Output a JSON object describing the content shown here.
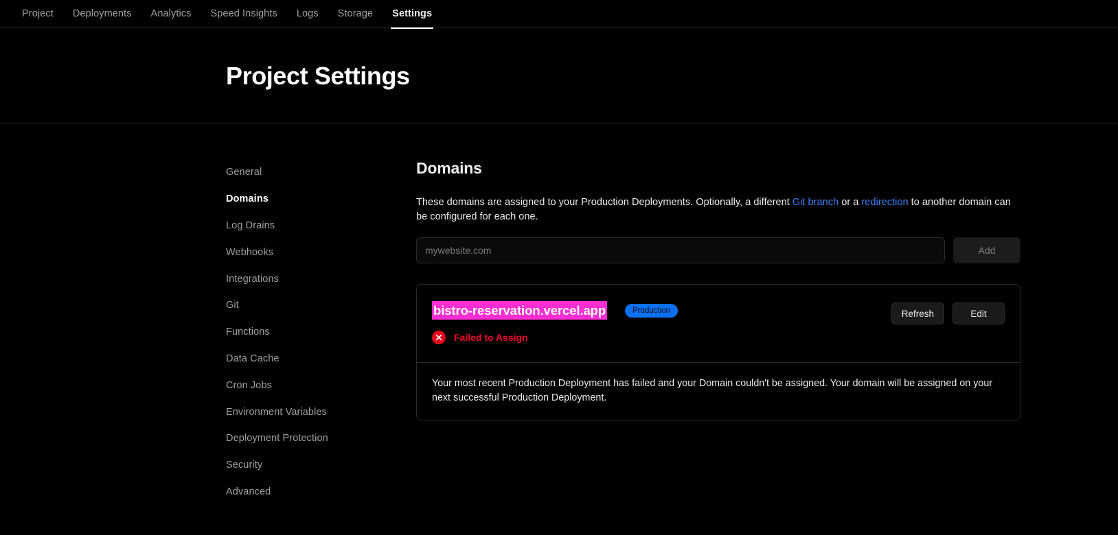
{
  "topnav": {
    "items": [
      {
        "label": "Project",
        "active": false
      },
      {
        "label": "Deployments",
        "active": false
      },
      {
        "label": "Analytics",
        "active": false
      },
      {
        "label": "Speed Insights",
        "active": false
      },
      {
        "label": "Logs",
        "active": false
      },
      {
        "label": "Storage",
        "active": false
      },
      {
        "label": "Settings",
        "active": true
      }
    ]
  },
  "header": {
    "title": "Project Settings"
  },
  "sidebar": {
    "items": [
      {
        "label": "General",
        "active": false
      },
      {
        "label": "Domains",
        "active": true
      },
      {
        "label": "Log Drains",
        "active": false
      },
      {
        "label": "Webhooks",
        "active": false
      },
      {
        "label": "Integrations",
        "active": false
      },
      {
        "label": "Git",
        "active": false
      },
      {
        "label": "Functions",
        "active": false
      },
      {
        "label": "Data Cache",
        "active": false
      },
      {
        "label": "Cron Jobs",
        "active": false
      },
      {
        "label": "Environment Variables",
        "active": false
      },
      {
        "label": "Deployment Protection",
        "active": false
      },
      {
        "label": "Security",
        "active": false
      },
      {
        "label": "Advanced",
        "active": false
      }
    ]
  },
  "main": {
    "section_title": "Domains",
    "description": {
      "part1": "These domains are assigned to your Production Deployments. Optionally, a different ",
      "link1": "Git branch",
      "part2": " or a ",
      "link2": "redirection",
      "part3": " to another domain can be configured for each one."
    },
    "add_form": {
      "input_value": "",
      "input_placeholder": "mywebsite.com",
      "add_label": "Add"
    },
    "domain_card": {
      "domain_name": "bistro-reservation.vercel.app",
      "domain_highlight_color": "#ff2ed2",
      "badge_label": "Production",
      "badge_color": "#0c70f2",
      "status_text": "Failed to Assign",
      "status_color": "#f5002a",
      "status_icon": "error-circle-x-icon",
      "refresh_label": "Refresh",
      "edit_label": "Edit",
      "note": "Your most recent Production Deployment has failed and your Domain couldn't be assigned. Your domain will be assigned on your next successful Production Deployment."
    }
  }
}
